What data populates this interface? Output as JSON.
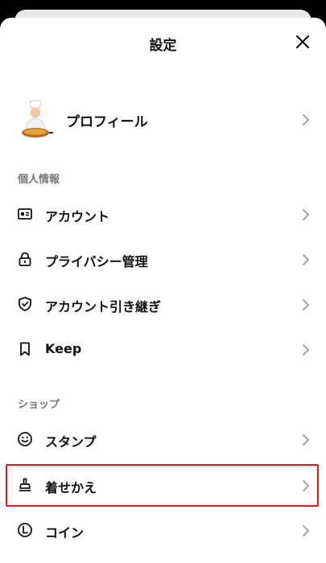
{
  "header": {
    "title": "設定"
  },
  "profile": {
    "label": "プロフィール"
  },
  "sections": {
    "personal": {
      "title": "個人情報",
      "items": [
        {
          "label": "アカウント",
          "icon": "id-card-icon"
        },
        {
          "label": "プライバシー管理",
          "icon": "lock-icon"
        },
        {
          "label": "アカウント引き継ぎ",
          "icon": "shield-check-icon"
        },
        {
          "label": "Keep",
          "icon": "bookmark-icon"
        }
      ]
    },
    "shop": {
      "title": "ショップ",
      "items": [
        {
          "label": "スタンプ",
          "icon": "smiley-icon"
        },
        {
          "label": "着せかえ",
          "icon": "brush-icon"
        },
        {
          "label": "コイン",
          "icon": "coin-icon"
        }
      ]
    }
  },
  "colors": {
    "highlight": "#e01818",
    "section_title": "#777777",
    "chevron": "#9a9a9a"
  }
}
